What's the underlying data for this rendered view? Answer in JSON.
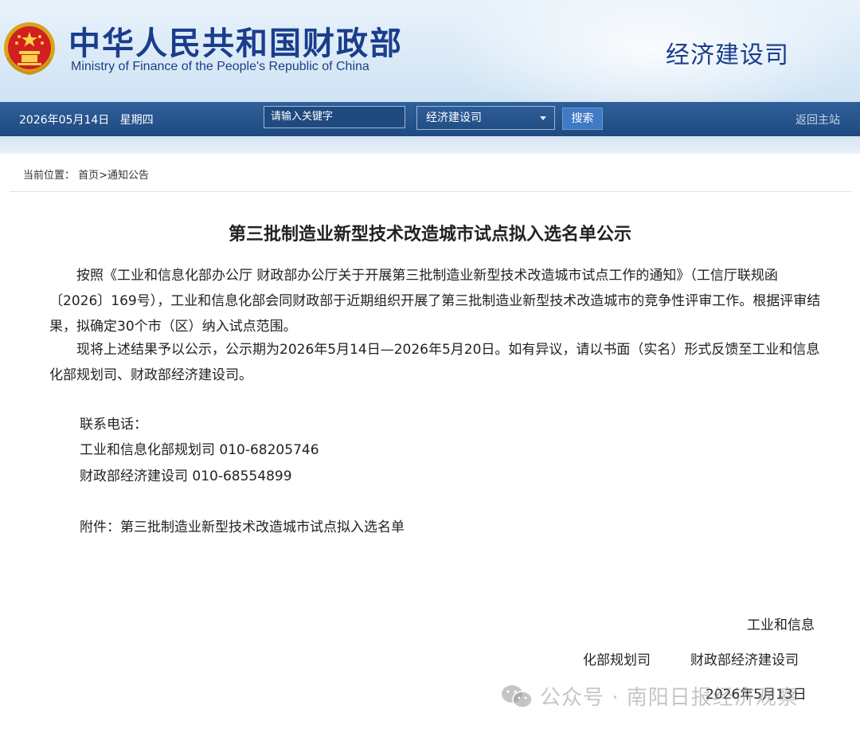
{
  "header": {
    "site_title": "中华人民共和国财政部",
    "site_subtitle": "Ministry of Finance of the People's Republic of China",
    "department": "经济建设司"
  },
  "navbar": {
    "date": "2026年05月14日   星期四",
    "search_placeholder": "请输入关键字",
    "select_value": "经济建设司",
    "search_button": "搜索",
    "home_link": "返回主站"
  },
  "breadcrumb": "当前位置： 首页>通知公告",
  "article": {
    "title": "第三批制造业新型技术改造城市试点拟入选名单公示",
    "paragraph1": "按照《工业和信息化部办公厅 财政部办公厅关于开展第三批制造业新型技术改造城市试点工作的通知》（工信厅联规函〔2026〕169号），工业和信息化部会同财政部于近期组织开展了第三批制造业新型技术改造城市的竞争性评审工作。根据评审结果，拟确定30个市（区）纳入试点范围。",
    "paragraph2": "现将上述结果予以公示，公示期为2026年5月14日—2026年5月20日。如有异议，请以书面（实名）形式反馈至工业和信息化部规划司、财政部经济建设司。",
    "contact_label": "联系电话：",
    "contact1": "工业和信息化部规划司 010-68205746",
    "contact2": "财政部经济建设司 010-68554899",
    "attachment": "附件：第三批制造业新型技术改造城市试点拟入选名单",
    "signature_line1": "工业和信息",
    "signature_line2_left": "化部规划司",
    "signature_line2_right": "财政部经济建设司",
    "signature_date": "2026年5月13日"
  },
  "watermark": "公众号 · 南阳日报经济观察",
  "colors": {
    "brand_blue": "#1a3d8c",
    "nav_bar": "#1f4a80",
    "button": "#3e7ac6"
  }
}
